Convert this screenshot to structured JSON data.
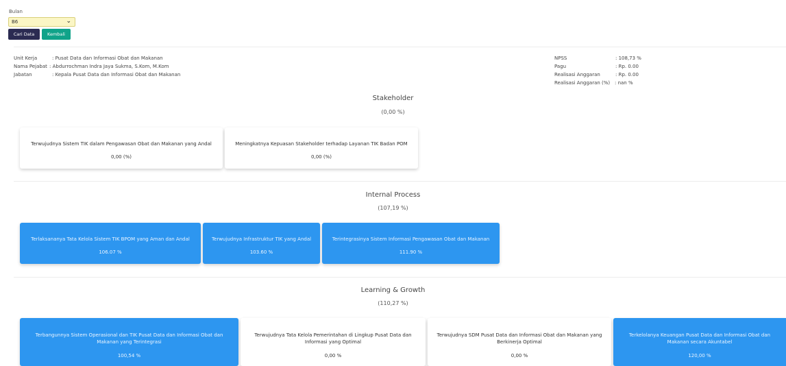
{
  "filter": {
    "label": "Bulan",
    "selected": "B6",
    "cari_label": "Cari Data",
    "kembali_label": "Kembali"
  },
  "info_left": [
    {
      "key": "Unit Kerja",
      "value": ": Pusat Data dan Informasi Obat dan Makanan"
    },
    {
      "key": "Nama Pejabat",
      "value": ": Abdurrochman Indra Jaya Sukma, S.Kom, M.Kom"
    },
    {
      "key": "Jabatan",
      "value": ": Kepala Pusat Data dan Informasi Obat dan Makanan"
    }
  ],
  "info_right": [
    {
      "key": "NPSS",
      "value": ": 108,73 %"
    },
    {
      "key": "Pagu",
      "value": ": Rp. 0.00"
    },
    {
      "key": "Realisasi Anggaran",
      "value": ": Rp. 0.00"
    },
    {
      "key": "Realisasi Anggaran (%)",
      "value": ": nan %"
    }
  ],
  "sections": [
    {
      "title": "Stakeholder",
      "pct": "(0,00 %)",
      "cards": [
        {
          "text": "Terwujudnya Sistem TIK dalam Pengawasan Obat dan Makanan yang Andal",
          "value": "0,00 (%)",
          "style": "white"
        },
        {
          "text": "Meningkatnya Kepuasan Stakeholder terhadap Layanan TIK Badan POM",
          "value": "0,00 (%)",
          "style": "white"
        }
      ]
    },
    {
      "title": "Internal Process",
      "pct": "(107,19 %)",
      "cards": [
        {
          "text": "Terlaksananya Tata Kelola Sistem TIK BPOM yang Aman dan Andal",
          "value": "106.07 %",
          "style": "blue"
        },
        {
          "text": "Terwujudnya Infrastruktur TIK yang Andal",
          "value": "103.60 %",
          "style": "blue"
        },
        {
          "text": "Terintegrasinya Sistem Informasi Pengawasan Obat dan Makanan",
          "value": "111.90 %",
          "style": "blue"
        }
      ]
    },
    {
      "title": "Learning & Growth",
      "pct": "(110,27 %)",
      "cards": [
        {
          "text": "Terbangunnya Sistem Operasional dan TIK Pusat Data dan Informasi Obat dan Makanan yang Terintegrasi",
          "value": "100,54 %",
          "style": "blue"
        },
        {
          "text": "Terwujudnya Tata Kelola Pemerintahan di Lingkup Pusat Data dan Informasi yang Optimal",
          "value": "0,00 %",
          "style": "white"
        },
        {
          "text": "Terwujudnya SDM Pusat Data dan Informasi Obat dan Makanan yang Berkinerja Optimal",
          "value": "0,00 %",
          "style": "white"
        },
        {
          "text": "Terkelolanya Keuangan Pusat Data dan Informasi Obat dan Makanan secara Akuntabel",
          "value": "120,00 %",
          "style": "blue"
        }
      ]
    }
  ],
  "colors": {
    "blue_card": "#2d96f0",
    "cari_button": "#2b2b52",
    "kembali_button": "#10a389",
    "select_bg": "#fbf6c5"
  }
}
